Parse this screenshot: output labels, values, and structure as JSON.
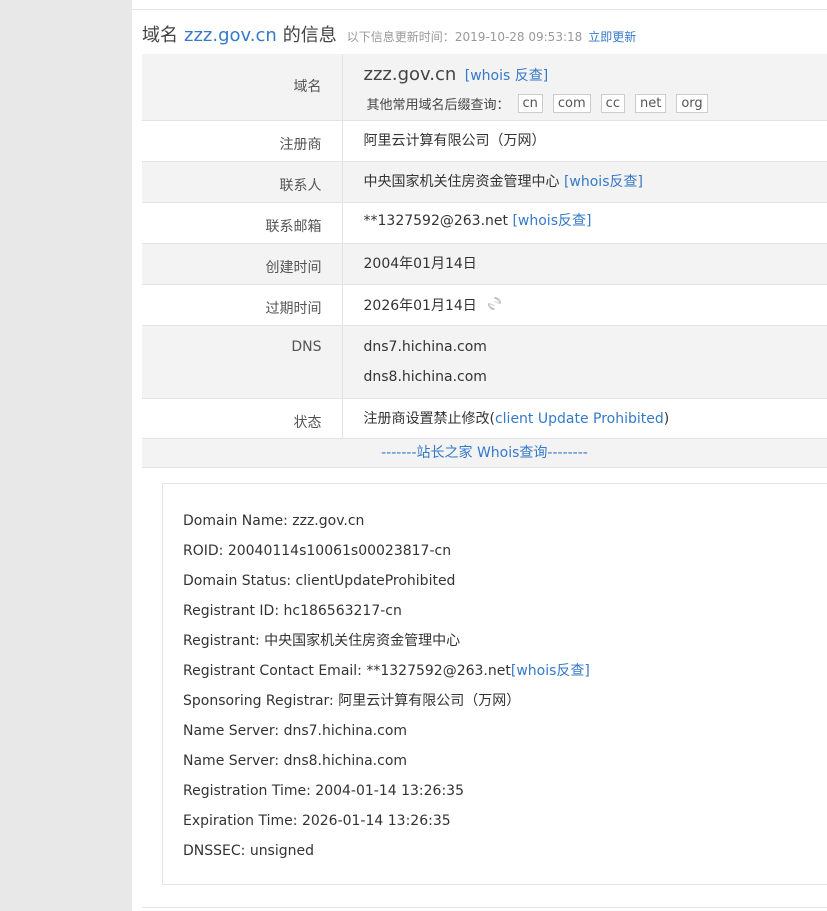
{
  "header": {
    "prefix": "域名",
    "domain": "zzz.gov.cn",
    "suffix": "的信息",
    "update_label": "以下信息更新时间：",
    "update_time": "2019-10-28 09:53:18",
    "refresh_link": "立即更新"
  },
  "info": {
    "domain": {
      "key": "域名",
      "value": "zzz.gov.cn",
      "whois_link": "[whois 反查]",
      "suffix_label": "其他常用域名后缀查询：",
      "suffixes": [
        "cn",
        "com",
        "cc",
        "net",
        "org"
      ]
    },
    "registrar": {
      "key": "注册商",
      "value": "阿里云计算有限公司（万网）"
    },
    "contact": {
      "key": "联系人",
      "value": "中央国家机关住房资金管理中心",
      "link": "[whois反查]"
    },
    "email": {
      "key": "联系邮箱",
      "value": "**1327592@263.net",
      "link": "[whois反查]"
    },
    "created": {
      "key": "创建时间",
      "value": "2004年01月14日"
    },
    "expires": {
      "key": "过期时间",
      "value": "2026年01月14日",
      "icon": "refresh-icon"
    },
    "dns": {
      "key": "DNS",
      "servers": [
        "dns7.hichina.com",
        "dns8.hichina.com"
      ]
    },
    "status": {
      "key": "状态",
      "value": "注册商设置禁止修改(",
      "link": "client Update Prohibited",
      "close": ")"
    }
  },
  "whois_bar": {
    "label": "-------站长之家 Whois查询--------"
  },
  "raw": {
    "lines": [
      "Domain Name: zzz.gov.cn",
      "ROID: 20040114s10061s00023817-cn",
      "Domain Status: clientUpdateProhibited",
      "Registrant ID: hc186563217-cn",
      "Registrant: 中央国家机关住房资金管理中心",
      "Registrant Contact Email: **1327592@263.net",
      "Sponsoring Registrar: 阿里云计算有限公司（万网）",
      "Name Server: dns7.hichina.com",
      "Name Server: dns8.hichina.com",
      "Registration Time: 2004-01-14 13:26:35",
      "Expiration Time: 2026-01-14 13:26:35",
      "DNSSEC: unsigned"
    ],
    "email_link": "[whois反查]"
  },
  "colors": {
    "link": "#3579c9",
    "row_gray": "#f3f3f3",
    "border": "#e3e3e3",
    "sidebar": "#e8e8e8"
  }
}
